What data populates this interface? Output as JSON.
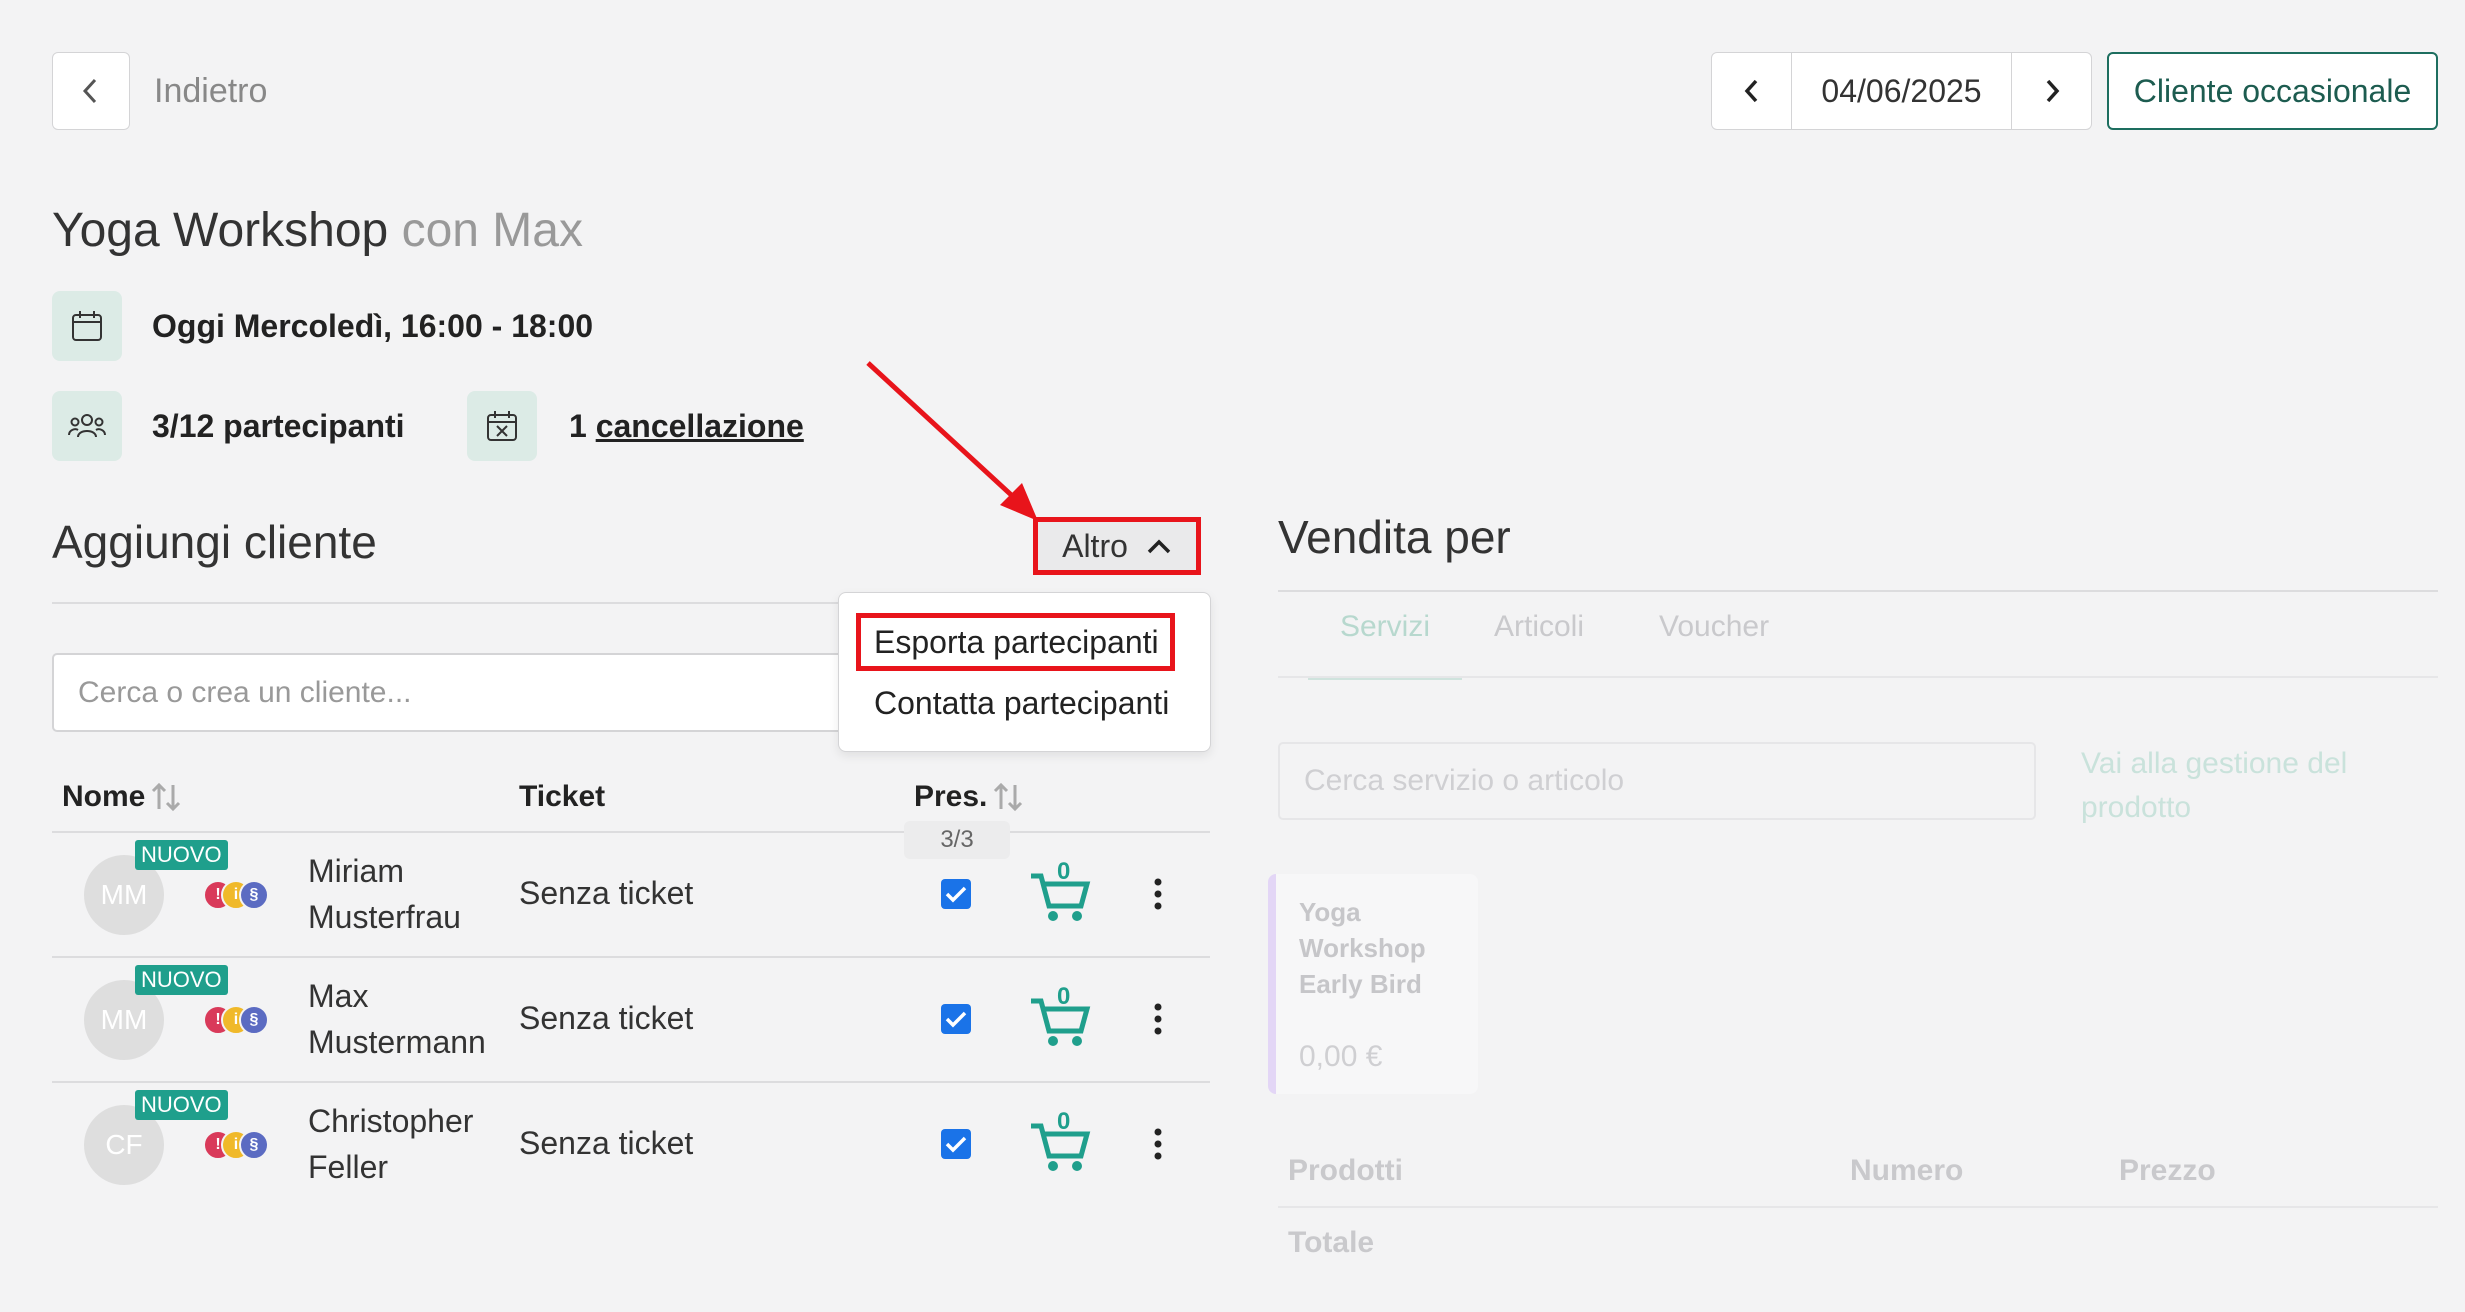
{
  "topbar": {
    "back_label": "Indietro",
    "date": "04/06/2025",
    "occasional_client": "Cliente occasionale"
  },
  "event": {
    "title": "Yoga Workshop",
    "with": "con Max",
    "when": "Oggi Mercoledì, 16:00 - 18:00",
    "participants": "3/12 partecipanti",
    "cancel_count": "1",
    "cancel_label": "cancellazione"
  },
  "add_client": {
    "heading": "Aggiungi cliente",
    "altro": "Altro",
    "search_placeholder": "Cerca o crea un cliente...",
    "menu": [
      "Esporta partecipanti",
      "Contatta partecipanti"
    ]
  },
  "table": {
    "headers": {
      "name": "Nome",
      "ticket": "Ticket",
      "pres": "Pres."
    },
    "pres_count": "3/3",
    "badge": "NUOVO",
    "rows": [
      {
        "initials": "MM",
        "first": "Miriam",
        "last": "Musterfrau",
        "ticket": "Senza ticket",
        "cart": "0"
      },
      {
        "initials": "MM",
        "first": "Max",
        "last": "Mustermann",
        "ticket": "Senza ticket",
        "cart": "0"
      },
      {
        "initials": "CF",
        "first": "Christopher",
        "last": "Feller",
        "ticket": "Senza ticket",
        "cart": "0"
      }
    ]
  },
  "sale": {
    "heading": "Vendita per",
    "tabs": [
      "Servizi",
      "Articoli",
      "Voucher"
    ],
    "search_placeholder": "Cerca servizio o articolo",
    "manage_link": "Vai alla gestione del prodotto",
    "product": {
      "name": "Yoga Workshop Early Bird",
      "price": "0,00 €"
    },
    "cols": {
      "products": "Prodotti",
      "number": "Numero",
      "price": "Prezzo"
    },
    "total": "Totale"
  },
  "colors": {
    "accent": "#1f9f8c",
    "highlight": "#e8141b",
    "checkbox": "#1a73e8"
  }
}
